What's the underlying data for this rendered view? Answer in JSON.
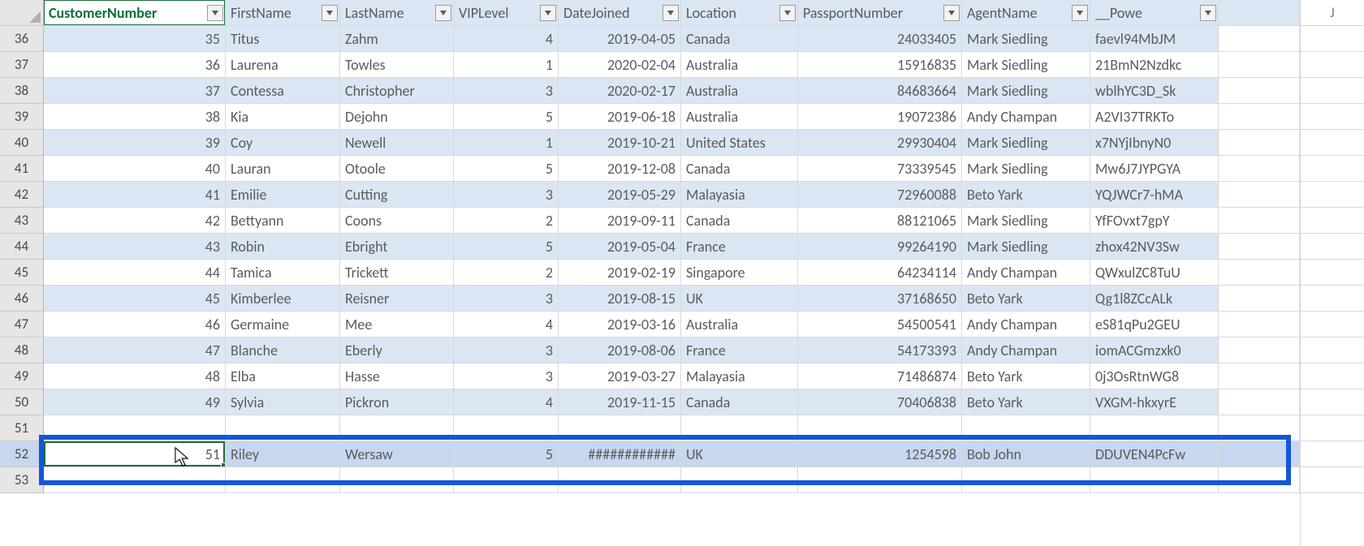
{
  "columns": [
    {
      "key": "CustomerNumber",
      "label": "CustomerNumber",
      "align": "num",
      "active": true
    },
    {
      "key": "FirstName",
      "label": "FirstName",
      "align": "txt"
    },
    {
      "key": "LastName",
      "label": "LastName",
      "align": "txt"
    },
    {
      "key": "VIPLevel",
      "label": "VIPLevel",
      "align": "num"
    },
    {
      "key": "DateJoined",
      "label": "DateJoined",
      "align": "num"
    },
    {
      "key": "Location",
      "label": "Location",
      "align": "txt"
    },
    {
      "key": "PassportNumber",
      "label": "PassportNumber",
      "align": "num"
    },
    {
      "key": "AgentName",
      "label": "AgentName",
      "align": "txt"
    },
    {
      "key": "PowerAppsId",
      "label": "__Powe",
      "align": "txt"
    }
  ],
  "extra_col_label": "J",
  "rows": [
    {
      "n": 36,
      "band": true,
      "d": {
        "CustomerNumber": "35",
        "FirstName": "Titus",
        "LastName": "Zahm",
        "VIPLevel": "4",
        "DateJoined": "2019-04-05",
        "Location": "Canada",
        "PassportNumber": "24033405",
        "AgentName": "Mark Siedling",
        "PowerAppsId": "faevl94MbJM"
      }
    },
    {
      "n": 37,
      "band": false,
      "d": {
        "CustomerNumber": "36",
        "FirstName": "Laurena",
        "LastName": "Towles",
        "VIPLevel": "1",
        "DateJoined": "2020-02-04",
        "Location": "Australia",
        "PassportNumber": "15916835",
        "AgentName": "Mark Siedling",
        "PowerAppsId": "21BmN2Nzdkc"
      }
    },
    {
      "n": 38,
      "band": true,
      "d": {
        "CustomerNumber": "37",
        "FirstName": "Contessa",
        "LastName": "Christopher",
        "VIPLevel": "3",
        "DateJoined": "2020-02-17",
        "Location": "Australia",
        "PassportNumber": "84683664",
        "AgentName": "Mark Siedling",
        "PowerAppsId": "wblhYC3D_Sk"
      }
    },
    {
      "n": 39,
      "band": false,
      "d": {
        "CustomerNumber": "38",
        "FirstName": "Kia",
        "LastName": "Dejohn",
        "VIPLevel": "5",
        "DateJoined": "2019-06-18",
        "Location": "Australia",
        "PassportNumber": "19072386",
        "AgentName": "Andy Champan",
        "PowerAppsId": "A2VI37TRKTo"
      }
    },
    {
      "n": 40,
      "band": true,
      "d": {
        "CustomerNumber": "39",
        "FirstName": "Coy",
        "LastName": "Newell",
        "VIPLevel": "1",
        "DateJoined": "2019-10-21",
        "Location": "United States",
        "PassportNumber": "29930404",
        "AgentName": "Mark Siedling",
        "PowerAppsId": "x7NYjIbnyN0"
      }
    },
    {
      "n": 41,
      "band": false,
      "d": {
        "CustomerNumber": "40",
        "FirstName": "Lauran",
        "LastName": "Otoole",
        "VIPLevel": "5",
        "DateJoined": "2019-12-08",
        "Location": "Canada",
        "PassportNumber": "73339545",
        "AgentName": "Mark Siedling",
        "PowerAppsId": "Mw6J7JYPGYA"
      }
    },
    {
      "n": 42,
      "band": true,
      "d": {
        "CustomerNumber": "41",
        "FirstName": "Emilie",
        "LastName": "Cutting",
        "VIPLevel": "3",
        "DateJoined": "2019-05-29",
        "Location": "Malayasia",
        "PassportNumber": "72960088",
        "AgentName": "Beto Yark",
        "PowerAppsId": "YQJWCr7-hMA"
      }
    },
    {
      "n": 43,
      "band": false,
      "d": {
        "CustomerNumber": "42",
        "FirstName": "Bettyann",
        "LastName": "Coons",
        "VIPLevel": "2",
        "DateJoined": "2019-09-11",
        "Location": "Canada",
        "PassportNumber": "88121065",
        "AgentName": "Mark Siedling",
        "PowerAppsId": "YfFOvxt7gpY"
      }
    },
    {
      "n": 44,
      "band": true,
      "d": {
        "CustomerNumber": "43",
        "FirstName": "Robin",
        "LastName": "Ebright",
        "VIPLevel": "5",
        "DateJoined": "2019-05-04",
        "Location": "France",
        "PassportNumber": "99264190",
        "AgentName": "Mark Siedling",
        "PowerAppsId": "zhox42NV3Sw"
      }
    },
    {
      "n": 45,
      "band": false,
      "d": {
        "CustomerNumber": "44",
        "FirstName": "Tamica",
        "LastName": "Trickett",
        "VIPLevel": "2",
        "DateJoined": "2019-02-19",
        "Location": "Singapore",
        "PassportNumber": "64234114",
        "AgentName": "Andy Champan",
        "PowerAppsId": "QWxulZC8TuU"
      }
    },
    {
      "n": 46,
      "band": true,
      "d": {
        "CustomerNumber": "45",
        "FirstName": "Kimberlee",
        "LastName": "Reisner",
        "VIPLevel": "3",
        "DateJoined": "2019-08-15",
        "Location": "UK",
        "PassportNumber": "37168650",
        "AgentName": "Beto Yark",
        "PowerAppsId": "Qg1l8ZCcALk"
      }
    },
    {
      "n": 47,
      "band": false,
      "d": {
        "CustomerNumber": "46",
        "FirstName": "Germaine",
        "LastName": "Mee",
        "VIPLevel": "4",
        "DateJoined": "2019-03-16",
        "Location": "Australia",
        "PassportNumber": "54500541",
        "AgentName": "Andy Champan",
        "PowerAppsId": "eS81qPu2GEU"
      }
    },
    {
      "n": 48,
      "band": true,
      "d": {
        "CustomerNumber": "47",
        "FirstName": "Blanche",
        "LastName": "Eberly",
        "VIPLevel": "3",
        "DateJoined": "2019-08-06",
        "Location": "France",
        "PassportNumber": "54173393",
        "AgentName": "Andy Champan",
        "PowerAppsId": "iomACGmzxk0"
      }
    },
    {
      "n": 49,
      "band": false,
      "d": {
        "CustomerNumber": "48",
        "FirstName": "Elba",
        "LastName": "Hasse",
        "VIPLevel": "3",
        "DateJoined": "2019-03-27",
        "Location": "Malayasia",
        "PassportNumber": "71486874",
        "AgentName": "Beto Yark",
        "PowerAppsId": "0j3OsRtnWG8"
      }
    },
    {
      "n": 50,
      "band": true,
      "d": {
        "CustomerNumber": "49",
        "FirstName": "Sylvia",
        "LastName": "Pickron",
        "VIPLevel": "4",
        "DateJoined": "2019-11-15",
        "Location": "Canada",
        "PassportNumber": "70406838",
        "AgentName": "Beto Yark",
        "PowerAppsId": "VXGM-hkxyrE"
      }
    },
    {
      "n": 51,
      "band": false,
      "d": {
        "CustomerNumber": "",
        "FirstName": "",
        "LastName": "",
        "VIPLevel": "",
        "DateJoined": "",
        "Location": "",
        "PassportNumber": "",
        "AgentName": "",
        "PowerAppsId": ""
      }
    }
  ],
  "insert_row": {
    "n": 52,
    "d": {
      "CustomerNumber": "51",
      "FirstName": "Riley",
      "LastName": "Wersaw",
      "VIPLevel": "5",
      "DateJoined": "############",
      "Location": "UK",
      "PassportNumber": "1254598",
      "AgentName": "Bob John",
      "PowerAppsId": "DDUVEN4PcFw"
    }
  },
  "post_rows": [
    {
      "n": 53
    }
  ],
  "colors": {
    "band": "#dbe6f4",
    "insert_bg": "#c7d7ef",
    "selection_border": "#1b6f3d",
    "highlight": "#1356d8"
  }
}
